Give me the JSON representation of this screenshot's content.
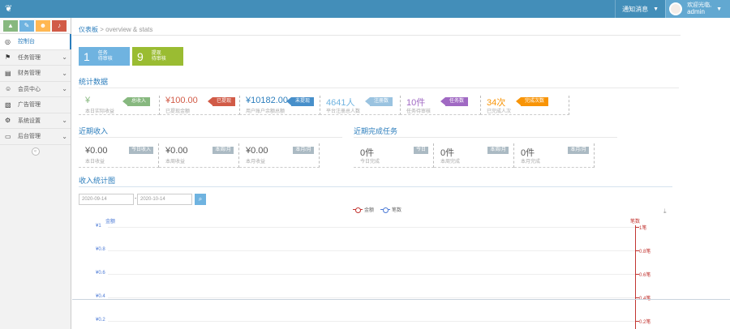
{
  "header": {
    "logo_icon": "leaf-icon",
    "menu_label": "通知消息",
    "user_greeting": "欢迎光临,",
    "user_name": "admin"
  },
  "sidebar": {
    "shortcuts": [
      {
        "icon": "signal-icon",
        "color": "#87b87f",
        "glyph": "▲"
      },
      {
        "icon": "pencil-icon",
        "color": "#6fb3e0",
        "glyph": "✎"
      },
      {
        "icon": "group-icon",
        "color": "#ffb752",
        "glyph": "☻"
      },
      {
        "icon": "bell-icon",
        "color": "#d15b47",
        "glyph": "♪"
      }
    ],
    "items": [
      {
        "label": "控制台",
        "icon": "dashboard-icon",
        "glyph": "◎",
        "active": true,
        "arrow": ""
      },
      {
        "label": "任务管理",
        "icon": "flag-icon",
        "glyph": "⚑",
        "active": false,
        "arrow": "⌄"
      },
      {
        "label": "财务管理",
        "icon": "money-icon",
        "glyph": "▤",
        "active": false,
        "arrow": "⌄"
      },
      {
        "label": "会员中心",
        "icon": "user-icon",
        "glyph": "☺",
        "active": false,
        "arrow": "⌄"
      },
      {
        "label": "广告管理",
        "icon": "picture-icon",
        "glyph": "▧",
        "active": false,
        "arrow": ""
      },
      {
        "label": "系统设置",
        "icon": "cog-icon",
        "glyph": "⚙",
        "active": false,
        "arrow": "⌄"
      },
      {
        "label": "后台管理",
        "icon": "desktop-icon",
        "glyph": "▭",
        "active": false,
        "arrow": "⌄"
      }
    ],
    "collapse_glyph": "«"
  },
  "breadcrumb": {
    "home": "仪表板",
    "sub": "> overview & stats"
  },
  "tiles": [
    {
      "num": "1",
      "line1": "任务",
      "line2": "待审核",
      "color": "#6fb3e0"
    },
    {
      "num": "9",
      "line1": "提现",
      "line2": "待审核",
      "color": "#9abc32"
    }
  ],
  "stats": {
    "title": "统计数据",
    "items": [
      {
        "value": "¥",
        "label": "本日实际收益",
        "value_color": "#87b87f",
        "badge": "总收入",
        "badge_color": "#87b87f"
      },
      {
        "value": "¥100.00",
        "label": "已提现金额",
        "value_color": "#d15b47",
        "badge": "已提现",
        "badge_color": "#d15b47"
      },
      {
        "value": "¥10182.00",
        "label": "用户账户余额总额",
        "value_color": "#2b7dbc",
        "badge": "未提现",
        "badge_color": "#478fca"
      },
      {
        "value": "4641人",
        "label": "平台注册总人数",
        "value_color": "#6fb3e0",
        "badge": "注册数",
        "badge_color": "#9ac3e0"
      },
      {
        "value": "10件",
        "label": "任务待审核",
        "value_color": "#a069c3",
        "badge": "任务数",
        "badge_color": "#a069c3"
      },
      {
        "value": "34次",
        "label": "已完成人次",
        "value_color": "#f89406",
        "badge": "完成次数",
        "badge_color": "#f89406"
      }
    ]
  },
  "income": {
    "title": "近期收入",
    "items": [
      {
        "value": "¥0.00",
        "label": "本日收益",
        "badge": "今日收入"
      },
      {
        "value": "¥0.00",
        "label": "本周收益",
        "badge": "本周/月"
      },
      {
        "value": "¥0.00",
        "label": "本月收益",
        "badge": "本月/月"
      }
    ]
  },
  "tasks": {
    "title": "近期完成任务",
    "items": [
      {
        "value": "0件",
        "label": "今日完成",
        "badge": "今日"
      },
      {
        "value": "0件",
        "label": "本周完成",
        "badge": "本周/月"
      },
      {
        "value": "0件",
        "label": "本月完成",
        "badge": "本月/月"
      }
    ]
  },
  "chart_section": {
    "title": "收入统计图",
    "date_start": "2020-09-14",
    "date_sep": "-",
    "date_end": "2020-10-14",
    "search_icon": "search-icon",
    "download_icon": "download-icon"
  },
  "chart_data": {
    "type": "line",
    "series": [
      {
        "name": "金额",
        "color": "#c23531",
        "values": []
      },
      {
        "name": "笔数",
        "color": "#4d7bd6",
        "values": []
      }
    ],
    "left_axis": {
      "title": "金额",
      "ticks": [
        "¥1",
        "¥0.8",
        "¥0.6",
        "¥0.4",
        "¥0.2"
      ],
      "ylim": [
        0,
        1
      ]
    },
    "right_axis": {
      "title": "笔数",
      "ticks": [
        "1笔",
        "0.8笔",
        "0.6笔",
        "0.4笔",
        "0.2笔"
      ],
      "ylim": [
        0,
        1
      ]
    },
    "grid": true,
    "legend": "top-center"
  }
}
